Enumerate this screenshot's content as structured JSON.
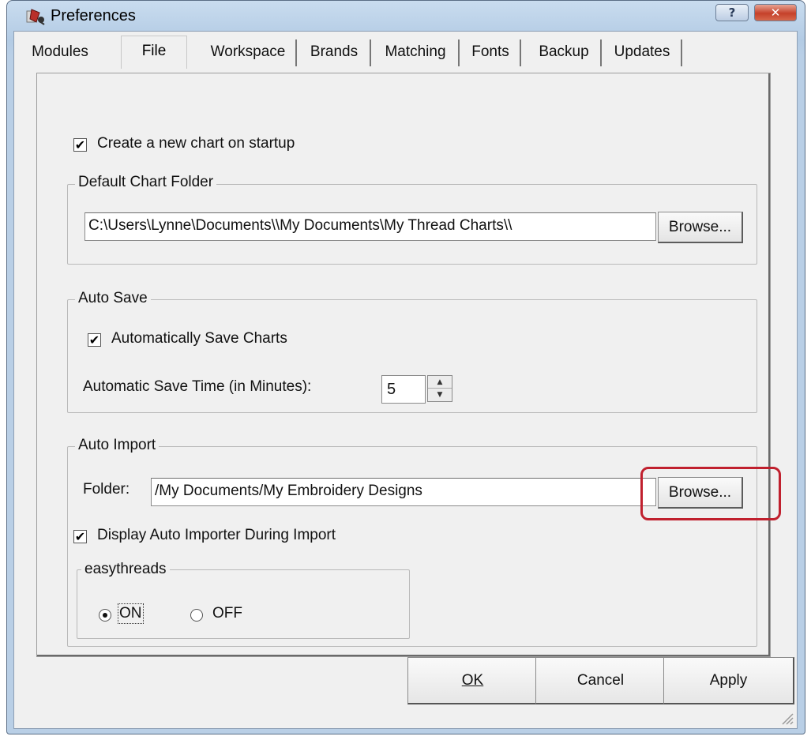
{
  "window": {
    "title": "Preferences",
    "help_label": "?",
    "close_label": "✕"
  },
  "tabs": [
    "Modules",
    "File",
    "Workspace",
    "Brands",
    "Matching",
    "Fonts",
    "Backup",
    "Updates"
  ],
  "active_tab": "File",
  "file_tab": {
    "create_new_chart": {
      "label": "Create a new chart on startup",
      "checked": true
    },
    "default_chart_folder": {
      "title": "Default Chart Folder",
      "path": "C:\\Users\\Lynne\\Documents\\\\My Documents\\My Thread Charts\\\\",
      "browse_label": "Browse..."
    },
    "auto_save": {
      "title": "Auto Save",
      "auto_save_charts": {
        "label": "Automatically Save Charts",
        "checked": true
      },
      "save_time_label": "Automatic Save Time (in Minutes):",
      "save_time_value": "5"
    },
    "auto_import": {
      "title": "Auto Import",
      "folder_label": "Folder:",
      "folder_value": "/My Documents/My Embroidery Designs",
      "browse_label": "Browse...",
      "display_importer": {
        "label": "Display Auto Importer During Import",
        "checked": true
      },
      "easythreads": {
        "title": "easythreads",
        "on_label": "ON",
        "off_label": "OFF",
        "selected": "ON"
      }
    }
  },
  "footer": {
    "ok_label": "OK",
    "cancel_label": "Cancel",
    "apply_label": "Apply"
  },
  "colors": {
    "highlight": "#c0202e",
    "title_gradient_top": "#c9dcef",
    "panel_bg": "#f0f0f0"
  }
}
